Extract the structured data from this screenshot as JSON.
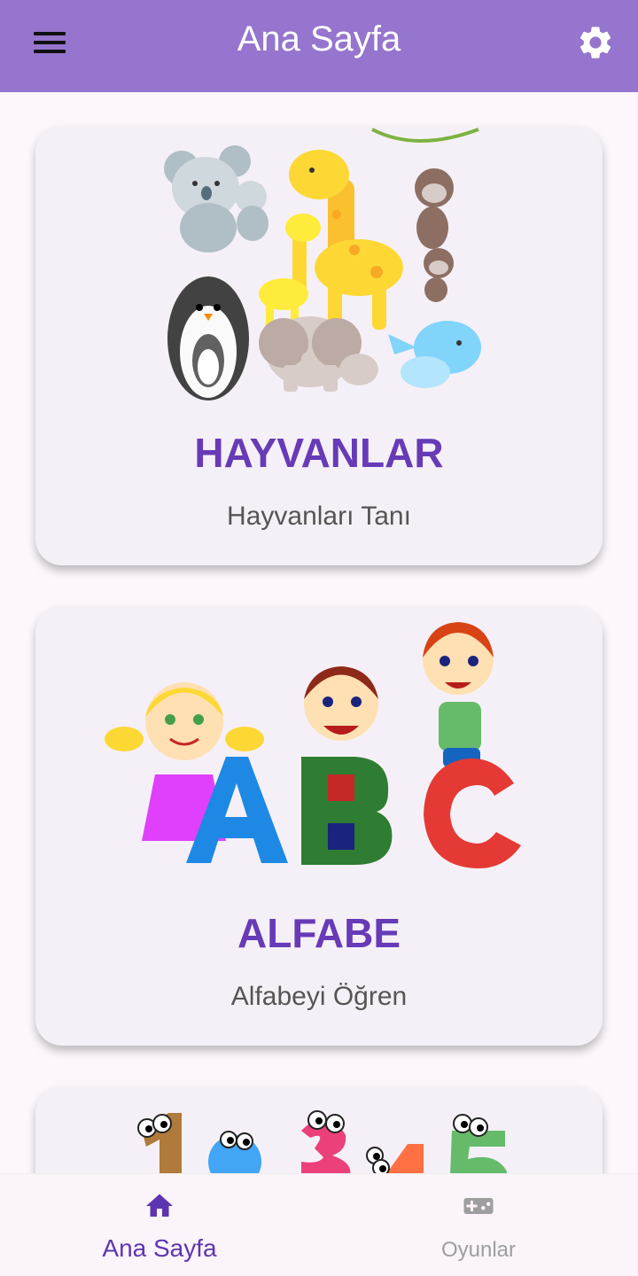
{
  "appbar": {
    "title": "Ana Sayfa",
    "menu_icon": "hamburger-menu-icon",
    "settings_icon": "gear-icon"
  },
  "cards": [
    {
      "title": "HAYVANLAR",
      "subtitle": "Hayvanları Tanı",
      "image": "animals-illustration"
    },
    {
      "title": "ALFABE",
      "subtitle": "Alfabeyi Öğren",
      "image": "abc-kids-illustration"
    },
    {
      "title": "",
      "subtitle": "",
      "image": "numbers-illustration"
    }
  ],
  "bottom_nav": {
    "items": [
      {
        "label": "Ana Sayfa",
        "icon": "home-icon",
        "active": true
      },
      {
        "label": "Oyunlar",
        "icon": "gamepad-icon",
        "active": false
      }
    ]
  },
  "colors": {
    "appbar": "#9575cd",
    "accent": "#673ab7",
    "card_bg": "#f5f0f7",
    "page_bg": "#fdf7fd"
  }
}
